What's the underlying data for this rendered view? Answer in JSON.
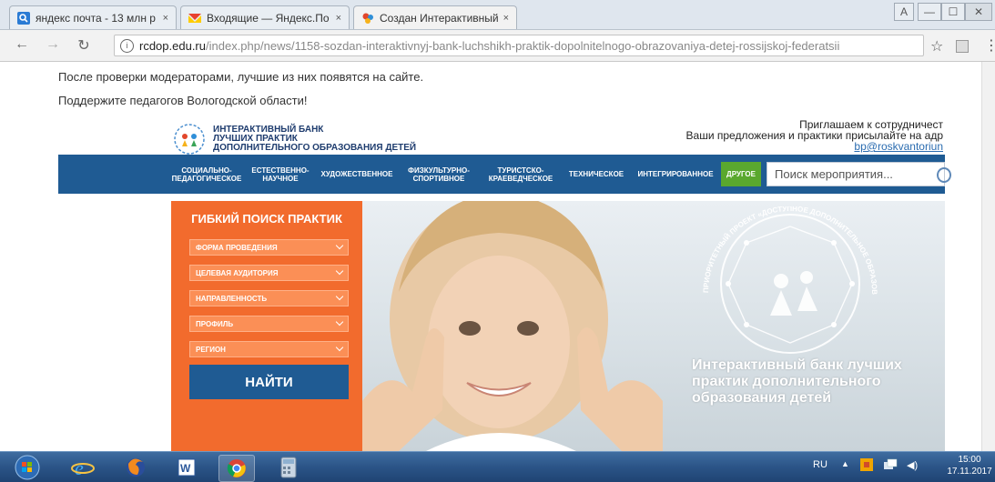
{
  "browser": {
    "tabs": [
      {
        "title": "яндекс почта - 13 млн р",
        "favicon": "search-icon",
        "close": "×"
      },
      {
        "title": "Входящие — Яндекс.По",
        "favicon": "mail-icon",
        "close": "×"
      },
      {
        "title": "Создан Интерактивный",
        "favicon": "site-icon",
        "close": "×",
        "active": true
      }
    ],
    "window_controls": [
      "А",
      "—",
      "☐",
      "✕"
    ],
    "address": {
      "domain": "rcdop.edu.ru",
      "path": "/index.php/news/1158-sozdan-interaktivnyj-bank-luchshikh-praktik-dopolnitelnogo-obrazovaniya-detej-rossijskoj-federatsii"
    }
  },
  "article": {
    "line1": "После проверки модераторами, лучшие из них появятся на сайте.",
    "line2": "Поддержите педагогов Вологодской области!"
  },
  "banner": {
    "logo_lines": [
      "ИНТЕРАКТИВНЫЙ БАНК",
      "ЛУЧШИХ ПРАКТИК",
      "ДОПОЛНИТЕЛЬНОГО ОБРАЗОВАНИЯ ДЕТЕЙ"
    ],
    "invite_line1": "Приглашаем к сотрудничест",
    "invite_line2": "Ваши предложения и практики присылайте на адр",
    "invite_email": "bp@roskvantoriun",
    "nav": [
      {
        "label": "СОЦИАЛЬНО-\nПЕДАГОГИЧЕСКОЕ"
      },
      {
        "label": "ЕСТЕСТВЕННО-\nНАУЧНОЕ"
      },
      {
        "label": "ХУДОЖЕСТВЕННОЕ"
      },
      {
        "label": "ФИЗКУЛЬТУРНО-\nСПОРТИВНОЕ"
      },
      {
        "label": "ТУРИСТСКО-\nКРАЕВЕДЧЕСКОЕ"
      },
      {
        "label": "ТЕХНИЧЕСКОЕ"
      },
      {
        "label": "ИНТЕГРИРОВАННОЕ"
      },
      {
        "label": "ДРУГОЕ",
        "highlight": true
      }
    ],
    "search_placeholder": "Поиск мероприятия...",
    "filter": {
      "title": "ГИБКИЙ ПОИСК ПРАКТИК",
      "selects": [
        "ФОРМА ПРОВЕДЕНИЯ",
        "ЦЕЛЕВАЯ АУДИТОРИЯ",
        "НАПРАВЛЕННОСТЬ",
        "ПРОФИЛЬ",
        "РЕГИОН"
      ],
      "button": "НАЙТИ"
    },
    "project_ring_text": "ПРИОРИТЕТНЫЙ ПРОЕКТ «ДОСТУПНОЕ ДОПОЛНИТЕЛЬНОЕ ОБРАЗОВАНИЕ ДЛЯ ДЕТЕЙ»",
    "hero_text": "Интерактивный банк лучших практик дополнительного образования детей"
  },
  "taskbar": {
    "lang": "RU",
    "time": "15:00",
    "date": "17.11.2017"
  },
  "colors": {
    "nav_blue": "#1f5b93",
    "filter_orange": "#f26b2d",
    "nav_green": "#5aa82e"
  }
}
